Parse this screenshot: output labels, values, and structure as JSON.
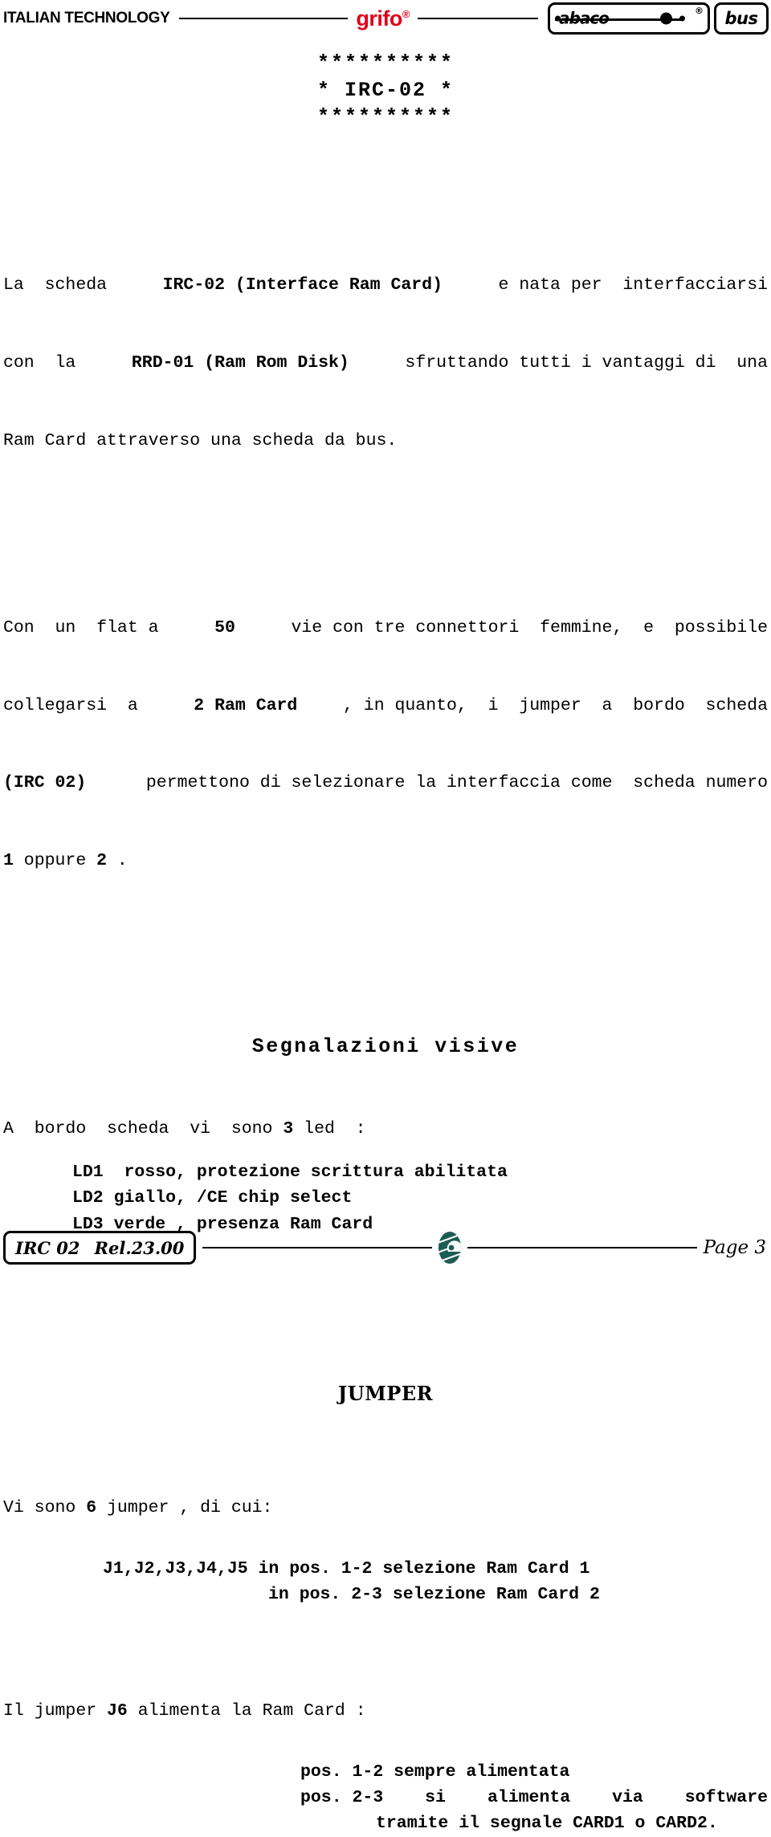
{
  "header": {
    "italian_technology": "ITALIAN TECHNOLOGY",
    "brand": "grifo",
    "brand_reg": "®",
    "abaco_word": "abaco",
    "abaco_reg": "®",
    "bus_word": "bus",
    "brand_color": "#e00018"
  },
  "title_block": {
    "line1": "**********",
    "line2": "* IRC-02 *",
    "line3": "**********"
  },
  "intro": {
    "l1_a": "La  scheda ",
    "l1_b": "IRC-02 (Interface Ram Card)",
    "l1_c": " e nata per  interfacciarsi",
    "l2_a": "con  la ",
    "l2_b": "RRD-01 (Ram Rom Disk)",
    "l2_c": " sfruttando tutti i vantaggi di  una",
    "l3": "Ram Card attraverso una scheda da bus."
  },
  "para2": {
    "l1_a": "Con  un  flat a ",
    "l1_b": "50",
    "l1_c": " vie con tre connettori  femmine,  e  possibile",
    "l2_a": "collegarsi  a ",
    "l2_b": "2 Ram Card",
    "l2_c": ", in quanto,  i  jumper  a  bordo  scheda",
    "l3_a": "(IRC 02)",
    "l3_b": " permettono di selezionare la interfaccia come  scheda numero",
    "l4_a": "1",
    "l4_b": " oppure ",
    "l4_c": "2",
    "l4_d": " ."
  },
  "section_leds": {
    "heading": "Segnalazioni visive",
    "intro_a": "A  bordo  scheda  vi  sono ",
    "intro_b": "3",
    "intro_c": " led  :",
    "items": [
      "LD1  rosso, protezione scrittura abilitata",
      "LD2 giallo, /CE chip select",
      "LD3 verde , presenza Ram Card"
    ]
  },
  "section_jumper": {
    "heading": "JUMPER",
    "intro_a": "Vi sono ",
    "intro_b": "6",
    "intro_c": " jumper , di cui:",
    "j15_line1": "J1,J2,J3,J4,J5 in pos. 1-2 selezione Ram Card 1",
    "j15_line2": "in pos. 2-3 selezione Ram Card 2",
    "j6_intro_a": "Il jumper ",
    "j6_intro_b": "J6",
    "j6_intro_c": " alimenta la Ram Card :",
    "j6_line1": "pos. 1-2 sempre alimentata",
    "j6_line2_left": "pos. 2-3",
    "j6_line2_mid1": "si",
    "j6_line2_mid2": "alimenta",
    "j6_line2_mid3": "via",
    "j6_line2_right": "software",
    "j6_line3": "tramite il segnale CARD1 o CARD2."
  },
  "footer": {
    "doc_code": "IRC 02",
    "revision": "Rel.23.00",
    "page": "Page 3",
    "logo_color": "#1b5c54"
  }
}
